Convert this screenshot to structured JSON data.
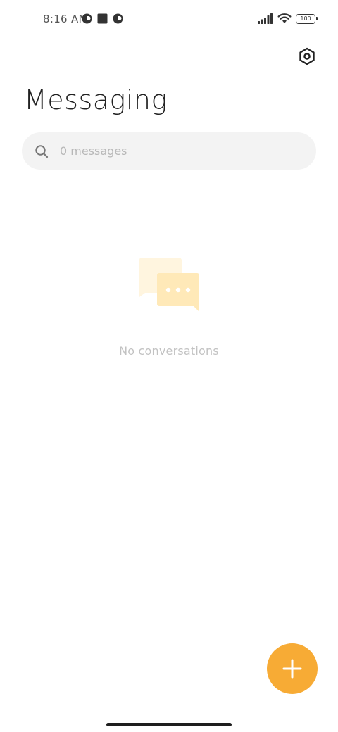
{
  "status_bar": {
    "time": "8:16 AM",
    "battery_level": "100",
    "icons": [
      "app-notification-icon",
      "stop-square-icon",
      "app-notification-icon",
      "signal-bars-icon",
      "wifi-icon",
      "battery-icon"
    ]
  },
  "header": {
    "title": "Messaging",
    "settings_icon": "settings-hex-icon"
  },
  "search": {
    "placeholder": "0 messages",
    "value": "",
    "icon": "search-icon"
  },
  "empty_state": {
    "icon": "chat-bubbles-icon",
    "text": "No conversations"
  },
  "fab": {
    "icon": "plus-icon",
    "color": "#f7ab35"
  },
  "colors": {
    "accent": "#f7ab35",
    "illustration_light": "#fff5df",
    "illustration_mid": "#ffe9b8"
  }
}
